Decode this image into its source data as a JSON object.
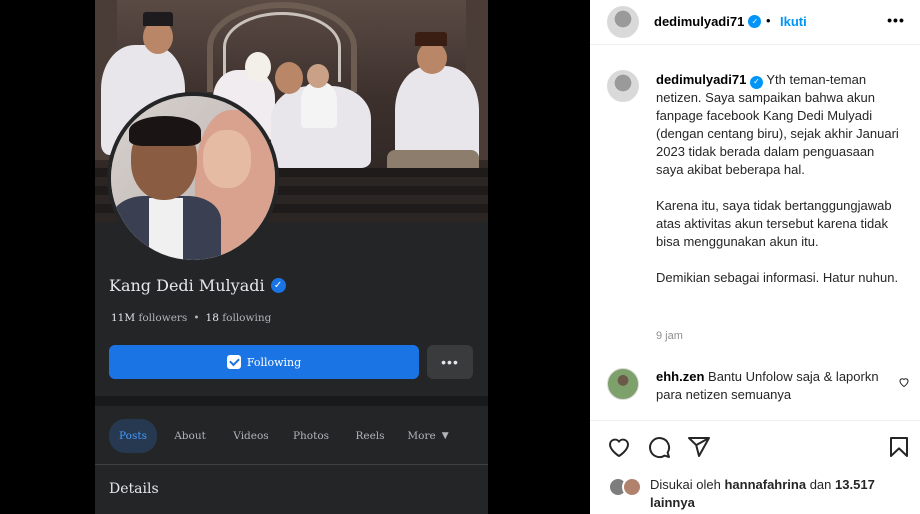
{
  "facebook_screenshot": {
    "name": "Kang Dedi Mulyadi",
    "followers_count": "11M",
    "followers_label": "followers",
    "following_count": "18",
    "following_label": "following",
    "follow_button_label": "Following",
    "more_button_label": "•••",
    "tabs": [
      "Posts",
      "About",
      "Videos",
      "Photos",
      "Reels",
      "More"
    ],
    "active_tab": "Posts",
    "section_title": "Details"
  },
  "header": {
    "username": "dedimulyadi71",
    "separator": "•",
    "follow_label": "Ikuti",
    "more_label": "•••"
  },
  "caption": {
    "username": "dedimulyadi71",
    "paragraphs": [
      "Yth teman-teman netizen. Saya sampaikan bahwa akun fanpage facebook Kang Dedi Mulyadi (dengan centang biru), sejak akhir Januari 2023 tidak berada dalam penguasaan saya akibat beberapa hal.",
      "Karena itu, saya tidak bertanggungjawab atas aktivitas akun tersebut karena tidak bisa menggunakan akun itu.",
      "Demikian sebagai informasi. Hatur nuhun."
    ],
    "time": "9 jam"
  },
  "comments": [
    {
      "username": "ehh.zen",
      "text": "Bantu Unfolow saja & laporkn para netizen semuanya"
    }
  ],
  "likes": {
    "prefix": "Disukai oleh",
    "user": "hannafahrina",
    "conjunction": "dan",
    "count": "13.517",
    "suffix": "lainnya"
  },
  "icons": {
    "like": "heart-icon",
    "comment": "comment-icon",
    "share": "share-icon",
    "save": "bookmark-icon"
  },
  "colors": {
    "fb_blue": "#1b74e4",
    "ig_blue": "#0095f6",
    "fb_dark": "#242526"
  }
}
